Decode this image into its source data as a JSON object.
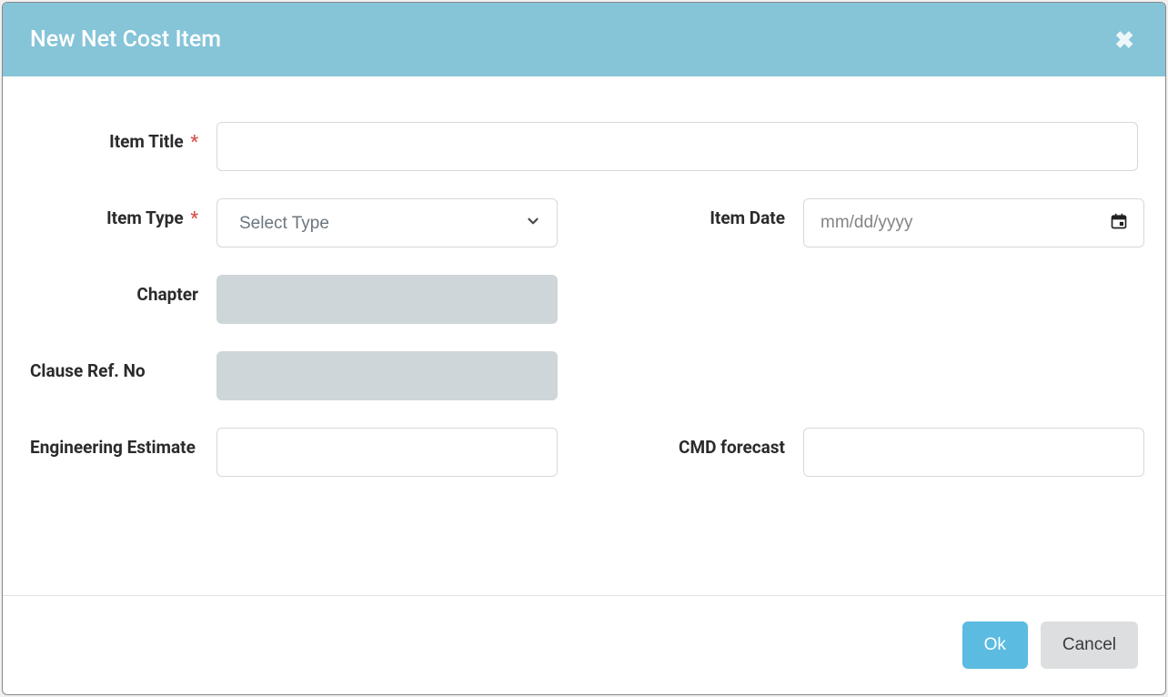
{
  "modal": {
    "title": "New Net Cost Item",
    "close_icon": "close-icon"
  },
  "form": {
    "item_title": {
      "label": "Item Title",
      "required_mark": "*",
      "value": ""
    },
    "item_type": {
      "label": "Item Type",
      "required_mark": "*",
      "placeholder": "Select Type",
      "value": ""
    },
    "item_date": {
      "label": "Item Date",
      "placeholder": "mm/dd/yyyy",
      "value": ""
    },
    "chapter": {
      "label": "Chapter",
      "value": ""
    },
    "clause_ref": {
      "label": "Clause Ref. No",
      "value": ""
    },
    "engineering_estimate": {
      "label": "Engineering Estimate",
      "value": ""
    },
    "cmd_forecast": {
      "label": "CMD forecast",
      "value": ""
    }
  },
  "footer": {
    "ok_label": "Ok",
    "cancel_label": "Cancel"
  }
}
